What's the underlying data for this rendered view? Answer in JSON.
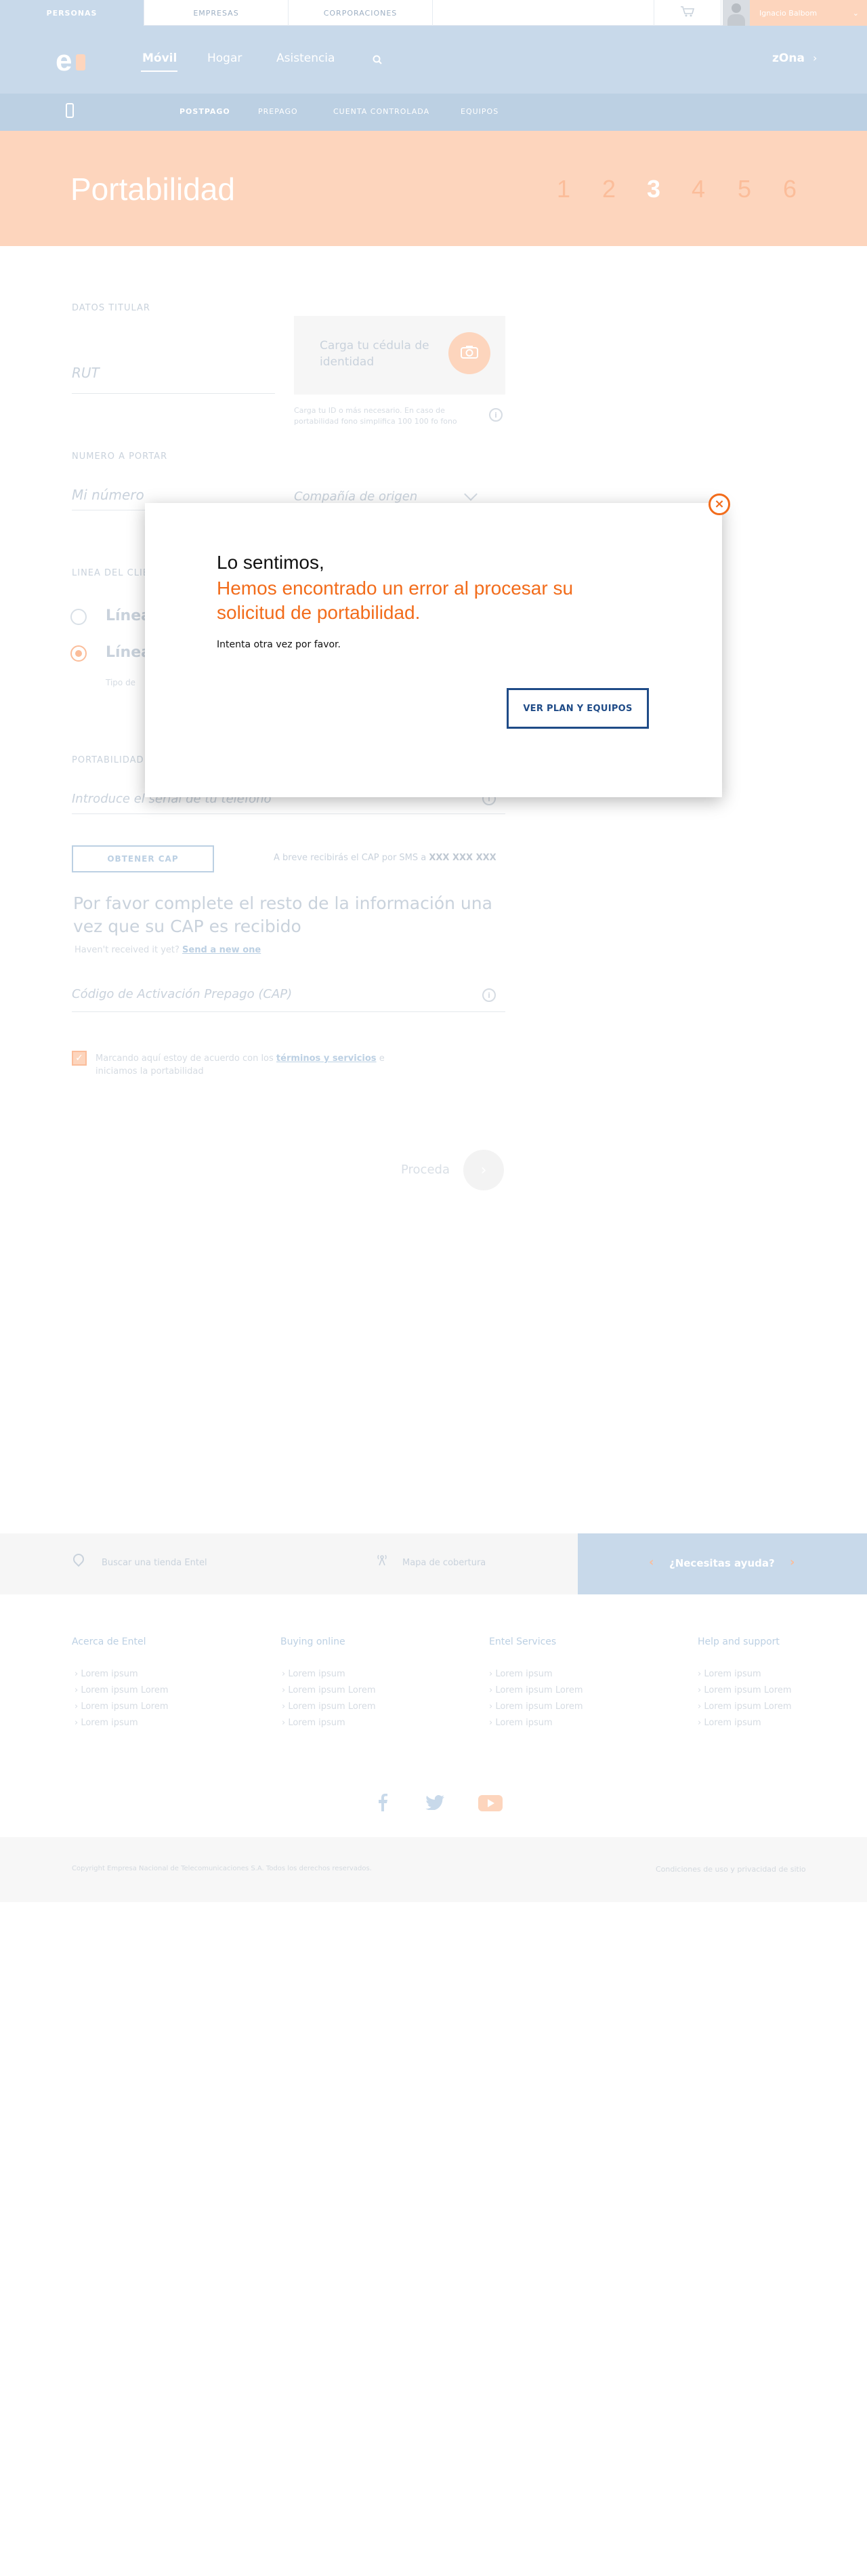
{
  "top_tabs": [
    "PERSONAS",
    "EMPRESAS",
    "CORPORACIONES"
  ],
  "user": {
    "name": "Ignacio Balbom"
  },
  "header": {
    "nav": [
      "Móvil",
      "Hogar",
      "Asistencia"
    ],
    "zona": "zOna"
  },
  "subnav": [
    "POSTPAGO",
    "PREPAGO",
    "CUENTA CONTROLADA",
    "EQUIPOS"
  ],
  "page_title": "Portabilidad",
  "steps": [
    "1",
    "2",
    "3",
    "4",
    "5",
    "6"
  ],
  "form": {
    "datos_titular": "DATOS TITULAR",
    "rut_placeholder": "RUT",
    "id_card_text": "Carga tu cédula de identidad",
    "id_card_note": "Carga tu ID o más necesario. En caso de portabilidad fono simplifica 100 100 fo fono",
    "numero_label": "NUMERO A PORTAR",
    "numero_placeholder": "Mi número",
    "compania_placeholder": "Compañía de origen",
    "linea_label": "LINEA DEL CLIENTE",
    "radio1": "Línea",
    "radio2": "Línea",
    "radio_note": "Tipo de",
    "portabilidad_label": "PORTABILIDAD",
    "serial_placeholder": "Introduce el serial de tu teléfono",
    "cap_button": "OBTENER CAP",
    "cap_note_prefix": "A breve recibirás el CAP por SMS a",
    "cap_note_number": "XXX XXX XXX",
    "complete_text": "Por favor complete el resto de la información una vez que su CAP es recibido",
    "resend_prefix": "Haven't received it yet?",
    "resend_link": "Send a new one",
    "cap_placeholder": "Código de Activación Prepago (CAP)",
    "terms_prefix": "Marcando aquí estoy de acuerdo con los",
    "terms_link": "términos y servicios",
    "terms_suffix": "e iniciamos la portabilidad",
    "proceed": "Proceda"
  },
  "modal": {
    "title": "Lo sentimos,",
    "error": "Hemos encontrado un error al procesar su solicitud de portabilidad.",
    "hint": "Intenta otra vez por favor.",
    "button": "VER PLAN Y EQUIPOS"
  },
  "footer": {
    "help_bar": {
      "store": "Buscar una tienda Entel",
      "coverage": "Mapa de cobertura",
      "help": "¿Necesitas ayuda?"
    },
    "columns": [
      {
        "title": "Acerca de Entel",
        "items": [
          "Lorem ipsum",
          "Lorem ipsum Lorem",
          "Lorem ipsum Lorem",
          "Lorem ipsum"
        ]
      },
      {
        "title": "Buying online",
        "items": [
          "Lorem ipsum",
          "Lorem ipsum Lorem",
          "Lorem ipsum Lorem",
          "Lorem ipsum"
        ]
      },
      {
        "title": "Entel Services",
        "items": [
          "Lorem ipsum",
          "Lorem ipsum Lorem",
          "Lorem ipsum Lorem",
          "Lorem ipsum"
        ]
      },
      {
        "title": "Help and support",
        "items": [
          "Lorem ipsum",
          "Lorem ipsum Lorem",
          "Lorem ipsum Lorem",
          "Lorem ipsum"
        ]
      }
    ],
    "copyright": "Copyright Empresa Nacional de Telecomunicaciones S.A. Todos los derechos reservados.",
    "policy": "Condiciones de uso y privacidad de sitio"
  },
  "colors": {
    "accent_orange": "#f26c1b",
    "modal_button_blue": "#1f4b87",
    "header_blue": "#c8d9ea",
    "title_band_peach": "#fdd5bd"
  }
}
